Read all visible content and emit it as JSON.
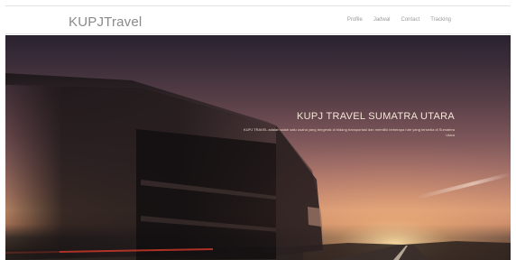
{
  "navbar": {
    "brand": "KUPJTravel",
    "links": [
      "Profile",
      "Jadwal",
      "Contact",
      "Tracking"
    ]
  },
  "hero": {
    "title": "KUPJ TRAVEL SUMATRA UTARA",
    "description": "KUPJ TRAVEL adalah salah satu usaha yang bergerak di bidang transportasi dan memiliki beberapa rute yang tersedia di Sumatera Utara"
  }
}
